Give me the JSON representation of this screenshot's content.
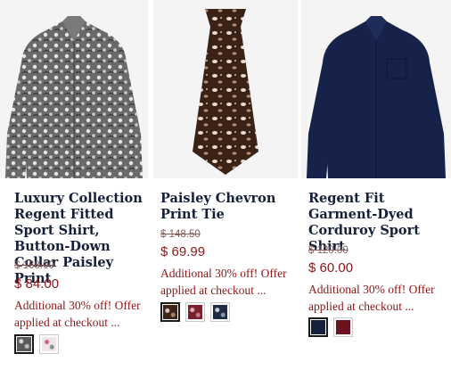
{
  "products": [
    {
      "title": "Luxury Collection Regent Fitted Sport Shirt, Button-Down Collar Paisley Print",
      "old_price": "$ 168.00",
      "price": "$ 84.00",
      "promo": "Additional 30% off! Offer applied at checkout ...",
      "swatches": [
        "paisley-dark",
        "paisley-pink"
      ],
      "selected_swatch": "paisley-dark"
    },
    {
      "title": "Paisley Chevron Print Tie",
      "old_price": "$ 148.50",
      "price": "$ 69.99",
      "promo": "Additional 30% off! Offer applied at checkout ...",
      "swatches": [
        "tie-brown",
        "tie-red",
        "tie-navy"
      ],
      "selected_swatch": "tie-brown"
    },
    {
      "title": "Regent Fit Garment-Dyed Corduroy Sport Shirt",
      "old_price": "$ 120.00",
      "price": "$ 60.00",
      "promo": "Additional 30% off! Offer applied at checkout ...",
      "swatches": [
        "navy",
        "burgundy"
      ],
      "selected_swatch": "navy"
    }
  ],
  "colors": {
    "title": "#14203a",
    "price": "#8b1717",
    "old_price": "#8a5a55",
    "image_bg": "#f4f4f4"
  }
}
